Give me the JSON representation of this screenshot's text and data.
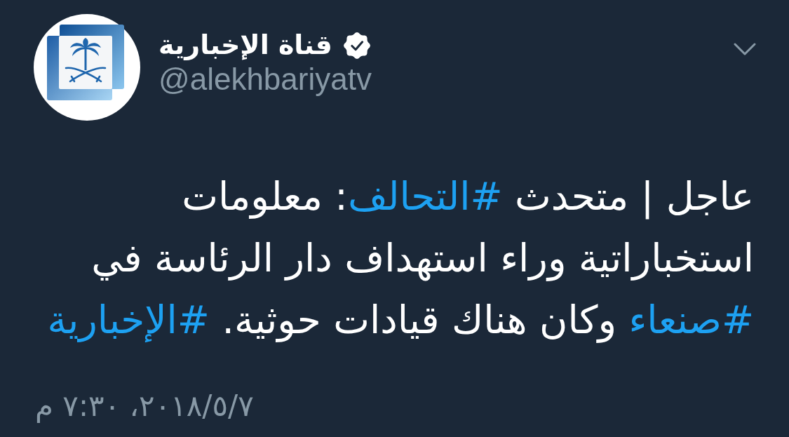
{
  "account": {
    "name": "قناة الإخبارية",
    "verified": true,
    "handle": "@alekhbariyatv"
  },
  "tweet": {
    "segments": [
      {
        "kind": "text",
        "text": "عاجل | متحدث "
      },
      {
        "kind": "hashtag",
        "text": "#التحالف"
      },
      {
        "kind": "text",
        "text": ": معلومات استخباراتية وراء استهداف دار الرئاسة في "
      },
      {
        "kind": "hashtag",
        "text": "#صنعاء"
      },
      {
        "kind": "text",
        "text": " وكان هناك قيادات حوثية. "
      },
      {
        "kind": "hashtag",
        "text": "#الإخبارية"
      }
    ]
  },
  "timestamp": "٢٠١٨/٥/٧، ٧:٣٠ م"
}
